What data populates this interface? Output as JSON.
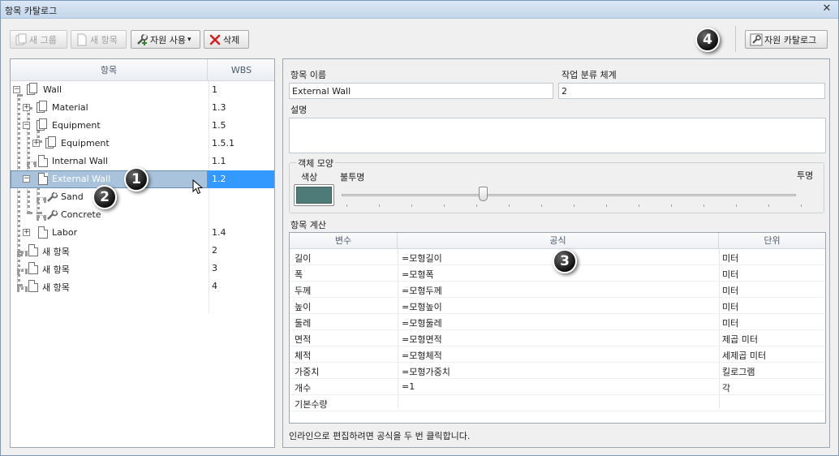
{
  "window": {
    "title": "항목 카탈로그",
    "close_glyph": "✕"
  },
  "toolbar": {
    "new_group": "새 그룹",
    "new_item": "새 항목",
    "use_resource": "자원 사용",
    "dropdown_glyph": "▾",
    "delete": "삭제",
    "resource_catalog": "자원 카탈로그"
  },
  "callouts": [
    "1",
    "2",
    "3",
    "4"
  ],
  "tree": {
    "header_item": "항목",
    "header_wbs": "WBS",
    "rows": [
      {
        "name": "Wall",
        "wbs": "1",
        "expander": "−"
      },
      {
        "name": "Material",
        "wbs": "1.3",
        "expander": "+"
      },
      {
        "name": "Equipment",
        "wbs": "1.5",
        "expander": "−"
      },
      {
        "name": "Equipment",
        "wbs": "1.5.1",
        "expander": "+"
      },
      {
        "name": "Internal Wall",
        "wbs": "1.1"
      },
      {
        "name": "External Wall",
        "wbs": "1.2",
        "expander": "−"
      },
      {
        "name": "Sand",
        "wbs": ""
      },
      {
        "name": "Concrete",
        "wbs": ""
      },
      {
        "name": "Labor",
        "wbs": "1.4",
        "expander": "+"
      },
      {
        "name": "새 항목",
        "wbs": "2"
      },
      {
        "name": "새 항목",
        "wbs": "3"
      },
      {
        "name": "새 항목",
        "wbs": "4"
      }
    ]
  },
  "details": {
    "item_name_label": "항목 이름",
    "item_name_value": "External Wall",
    "wbs_label": "작업 분류 체계",
    "wbs_value": "2",
    "description_label": "설명",
    "description_value": "",
    "appearance_label": "객체 모양",
    "color_label": "색상",
    "color_value": "#4e7a77",
    "opaque_label": "불투명",
    "transparent_label": "투명",
    "transparency": 0.31,
    "calc_label": "항목 계산",
    "hint": "인라인으로 편집하려면 공식을 두 번 클릭합니다."
  },
  "calc_table": {
    "headers": [
      "변수",
      "공식",
      "단위"
    ],
    "rows": [
      [
        "길이",
        "=모형길이",
        "미터"
      ],
      [
        "폭",
        "=모형폭",
        "미터"
      ],
      [
        "두께",
        "=모형두께",
        "미터"
      ],
      [
        "높이",
        "=모형높이",
        "미터"
      ],
      [
        "둘레",
        "=모형둘레",
        "미터"
      ],
      [
        "면적",
        "=모형면적",
        "제곱 미터"
      ],
      [
        "체적",
        "=모형체적",
        "세제곱 미터"
      ],
      [
        "가중치",
        "=모형가중치",
        "킬로그램"
      ],
      [
        "개수",
        "=1",
        "각"
      ],
      [
        "기본수량",
        "",
        ""
      ]
    ]
  }
}
